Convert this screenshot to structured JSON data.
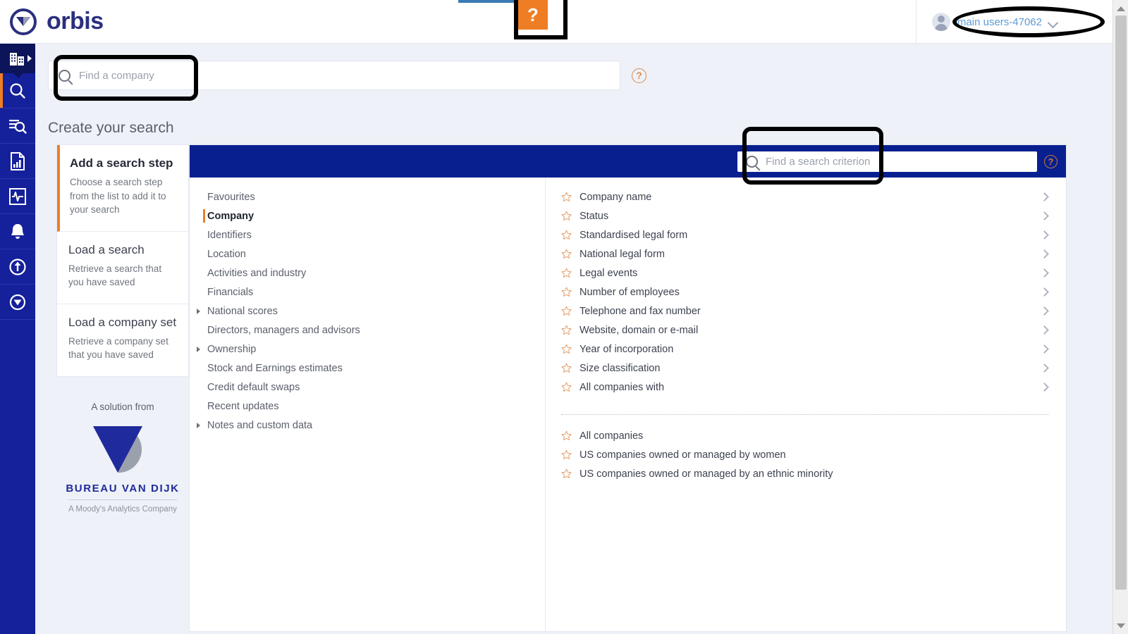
{
  "brand": {
    "logo_text": "orbis",
    "logo_icon": "orbis-circle-icon",
    "accent_orange": "#ef7d23",
    "primary_navy": "#08208f",
    "rail_blue": "#15209b"
  },
  "topbar": {
    "help_button_label": "?",
    "help_button_icon": "question-mark-icon",
    "user": {
      "name": "main users-47062",
      "avatar_icon": "user-avatar-icon",
      "dropdown_icon": "chevron-down-icon"
    }
  },
  "sidebar": {
    "items": [
      {
        "name": "companies",
        "icon": "buildings-icon",
        "active": false,
        "has_arrow": true
      },
      {
        "name": "search",
        "icon": "magnifier-icon",
        "active": true,
        "has_arrow": false
      },
      {
        "name": "saved-searches",
        "icon": "list-search-icon",
        "active": false,
        "has_arrow": false
      },
      {
        "name": "reports",
        "icon": "document-chart-icon",
        "active": false,
        "has_arrow": false
      },
      {
        "name": "analysis",
        "icon": "pulse-monitor-icon",
        "active": false,
        "has_arrow": false
      },
      {
        "name": "alerts",
        "icon": "bell-icon",
        "active": false,
        "has_arrow": false
      },
      {
        "name": "upload",
        "icon": "upload-circle-icon",
        "active": false,
        "has_arrow": false
      },
      {
        "name": "orbis-menu",
        "icon": "orbis-circle-icon",
        "active": false,
        "has_arrow": false
      }
    ]
  },
  "company_search": {
    "placeholder": "Find a company",
    "value": "",
    "search_icon": "magnifier-icon",
    "help_icon": "question-circle-icon",
    "help_label": "?"
  },
  "page": {
    "title": "Create your search"
  },
  "steps": [
    {
      "title": "Add a search step",
      "description": "Choose a search step from the list to add it to your search",
      "active": true
    },
    {
      "title": "Load a search",
      "description": "Retrieve a search that you have saved",
      "active": false
    },
    {
      "title": "Load a company set",
      "description": "Retrieve a company set that you have saved",
      "active": false
    }
  ],
  "solution": {
    "label": "A solution from",
    "company": "BUREAU VAN DIJK",
    "tagline": "A Moody's Analytics Company",
    "logo_icon": "bureau-van-dijk-logo"
  },
  "criterion_search": {
    "placeholder": "Find a search criterion",
    "value": "",
    "search_icon": "magnifier-icon",
    "help_icon": "question-circle-icon",
    "help_label": "?"
  },
  "categories": [
    {
      "label": "Favourites",
      "selected": false,
      "expandable": false
    },
    {
      "label": "Company",
      "selected": true,
      "expandable": false
    },
    {
      "label": "Identifiers",
      "selected": false,
      "expandable": false
    },
    {
      "label": "Location",
      "selected": false,
      "expandable": false
    },
    {
      "label": "Activities and industry",
      "selected": false,
      "expandable": false
    },
    {
      "label": "Financials",
      "selected": false,
      "expandable": false
    },
    {
      "label": "National scores",
      "selected": false,
      "expandable": true
    },
    {
      "label": "Directors, managers and advisors",
      "selected": false,
      "expandable": false
    },
    {
      "label": "Ownership",
      "selected": false,
      "expandable": true
    },
    {
      "label": "Stock and Earnings estimates",
      "selected": false,
      "expandable": false
    },
    {
      "label": "Credit default swaps",
      "selected": false,
      "expandable": false
    },
    {
      "label": "Recent updates",
      "selected": false,
      "expandable": false
    },
    {
      "label": "Notes and custom data",
      "selected": false,
      "expandable": true
    }
  ],
  "criteria": [
    {
      "label": "Company name",
      "has_chevron": true
    },
    {
      "label": "Status",
      "has_chevron": true
    },
    {
      "label": "Standardised legal form",
      "has_chevron": true
    },
    {
      "label": "National legal form",
      "has_chevron": true
    },
    {
      "label": "Legal events",
      "has_chevron": true
    },
    {
      "label": "Number of employees",
      "has_chevron": true
    },
    {
      "label": "Telephone and fax number",
      "has_chevron": true
    },
    {
      "label": "Website, domain or e-mail",
      "has_chevron": true
    },
    {
      "label": "Year of incorporation",
      "has_chevron": true
    },
    {
      "label": "Size classification",
      "has_chevron": true
    },
    {
      "label": "All companies with",
      "has_chevron": true
    }
  ],
  "criteria_extra": [
    {
      "label": "All companies",
      "has_chevron": false
    },
    {
      "label": "US companies owned or managed by women",
      "has_chevron": false
    },
    {
      "label": "US companies owned or managed by an ethnic minority",
      "has_chevron": false
    }
  ],
  "annotations": [
    {
      "name": "company-search-highlight",
      "shape": "rounded-rect"
    },
    {
      "name": "help-button-highlight",
      "shape": "rect"
    },
    {
      "name": "user-menu-highlight",
      "shape": "ellipse"
    },
    {
      "name": "criterion-search-highlight",
      "shape": "rounded-rect"
    }
  ]
}
